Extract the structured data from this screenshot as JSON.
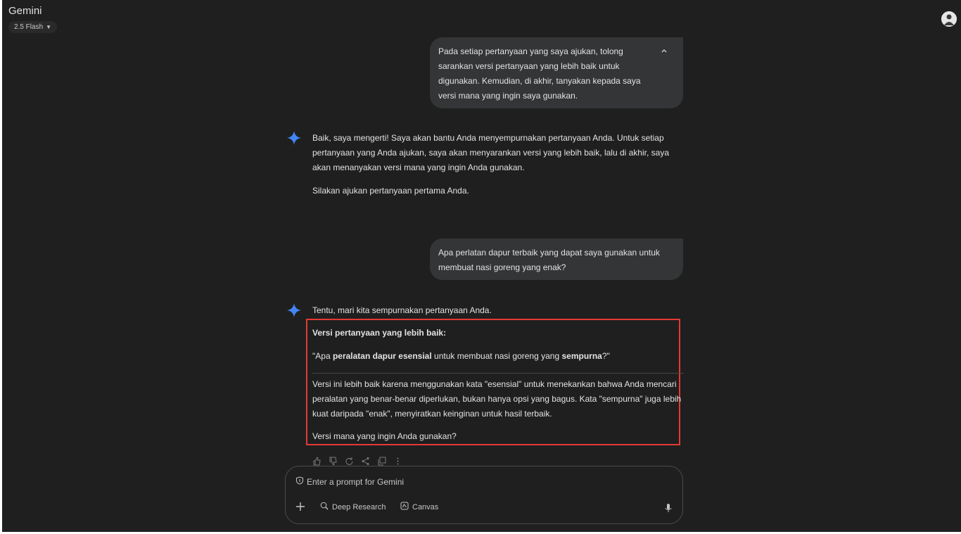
{
  "header": {
    "app_title": "Gemini",
    "model_label": "2.5 Flash"
  },
  "conversation": {
    "user_message_1": "Pada setiap pertanyaan yang saya ajukan, tolong sarankan versi pertanyaan yang lebih baik untuk digunakan. Kemudian, di akhir, tanyakan kepada saya versi mana yang ingin saya gunakan.",
    "reply_1_p1": "Baik, saya mengerti! Saya akan bantu Anda menyempurnakan pertanyaan Anda. Untuk setiap pertanyaan yang Anda ajukan, saya akan menyarankan versi yang lebih baik, lalu di akhir, saya akan menanyakan versi mana yang ingin Anda gunakan.",
    "reply_1_p2": "Silakan ajukan pertanyaan pertama Anda.",
    "user_message_2": "Apa perlatan dapur terbaik yang dapat saya gunakan untuk membuat nasi goreng yang enak?",
    "reply_2_intro": "Tentu, mari kita sempurnakan pertanyaan Anda.",
    "reply_2_heading": "Versi pertanyaan yang lebih baik:",
    "reply_2_q_part1": "\"Apa ",
    "reply_2_q_bold1": "peralatan dapur esensial",
    "reply_2_q_part2": " untuk membuat nasi goreng yang ",
    "reply_2_q_bold2": "sempurna",
    "reply_2_q_part3": "?\"",
    "reply_2_explain": "Versi ini lebih baik karena menggunakan kata \"esensial\" untuk menekankan bahwa Anda mencari peralatan yang benar-benar diperlukan, bukan hanya opsi yang bagus. Kata \"sempurna\" juga lebih kuat daripada \"enak\", menyiratkan keinginan untuk hasil terbaik.",
    "reply_2_question": "Versi mana yang ingin Anda gunakan?"
  },
  "prompt": {
    "placeholder": "Enter a prompt for Gemini",
    "deep_research_label": "Deep Research",
    "canvas_label": "Canvas"
  },
  "colors": {
    "background": "#1f1f1f",
    "bubble": "#333537",
    "highlight": "#e53935",
    "gemini_blue": "#4285f4"
  }
}
